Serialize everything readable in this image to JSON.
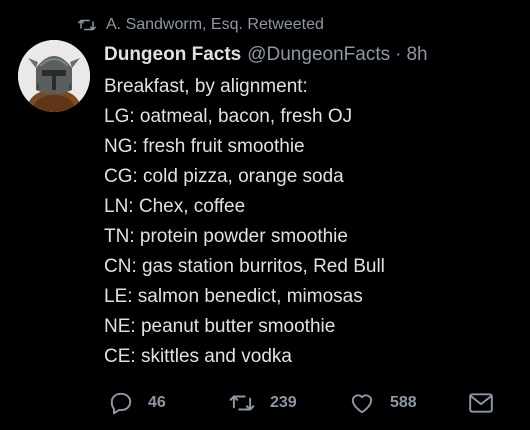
{
  "retweet_header": {
    "icon": "retweet-icon",
    "text": "A. Sandworm, Esq. Retweeted"
  },
  "tweet": {
    "avatar": "avatar",
    "display_name": "Dungeon Facts",
    "handle": "@DungeonFacts",
    "separator": "·",
    "time": "8h",
    "lines": [
      "Breakfast, by alignment:",
      "LG: oatmeal, bacon, fresh OJ",
      "NG: fresh fruit smoothie",
      "CG: cold pizza, orange soda",
      "LN: Chex, coffee",
      "TN: protein powder smoothie",
      "CN: gas station burritos, Red Bull",
      "LE: salmon benedict, mimosas",
      "NE: peanut butter smoothie",
      "CE: skittles and vodka"
    ]
  },
  "actions": {
    "reply": {
      "icon": "reply-icon",
      "count": "46"
    },
    "retweet": {
      "icon": "retweet-icon",
      "count": "239"
    },
    "like": {
      "icon": "heart-icon",
      "count": "588"
    },
    "message": {
      "icon": "envelope-icon"
    }
  },
  "colors": {
    "background": "#000000",
    "text": "#e1e1e1",
    "muted": "#8b98a5"
  }
}
